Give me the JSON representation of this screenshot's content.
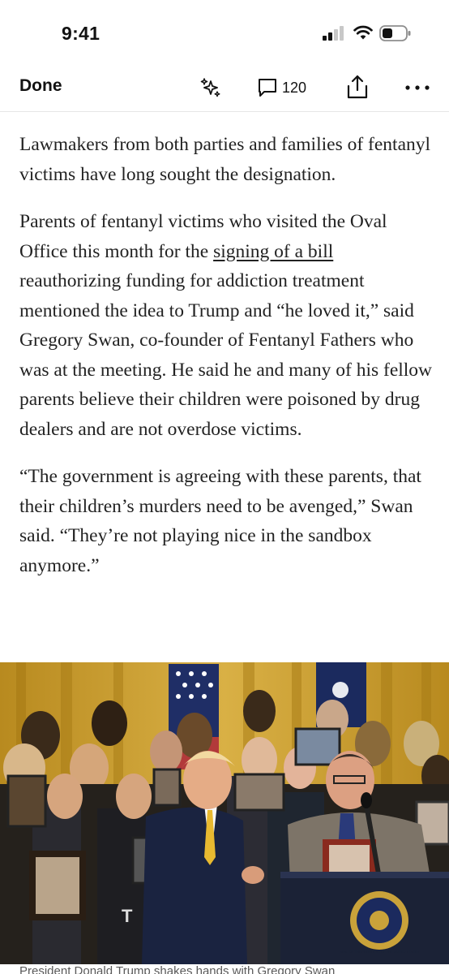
{
  "status_bar": {
    "time": "9:41",
    "icons": [
      "cellular-signal-icon",
      "wifi-icon",
      "battery-icon"
    ]
  },
  "nav": {
    "done_label": "Done",
    "comment_count": "120",
    "icons": [
      "sparkle-icon",
      "comment-icon",
      "share-icon",
      "more-icon"
    ]
  },
  "article": {
    "paragraph_1": "Lawmakers from both parties and families of fentanyl victims have long sought the designation.",
    "paragraph_2_before_link": "Parents of fentanyl victims who visited the Oval Office this month for the ",
    "paragraph_2_link": "signing of a bill",
    "paragraph_2_after_link": " reauthorizing funding for addiction treatment mentioned the idea to Trump and “he loved it,” said Gregory Swan, co-founder of Fentanyl Fathers who was at the meeting. He said he and many of his fellow parents believe their children were poisoned by drug dealers and are not overdose victims.",
    "paragraph_3": "“The government is agreeing with these parents, that their children’s murders need to be avenged,” Swan said. “They’re not playing nice in the sandbox anymore.”"
  },
  "photo": {
    "seal_text": "SEAL OF THE PRESIDENT OF THE UNITED STATES",
    "podium_text": "T"
  },
  "caption": "President Donald Trump shakes hands with Gregory Swan",
  "colors": {
    "text": "#222222",
    "curtain_gold": "#c9a233",
    "podium_navy": "#1b2236",
    "seal_gold": "#c9a23a"
  }
}
